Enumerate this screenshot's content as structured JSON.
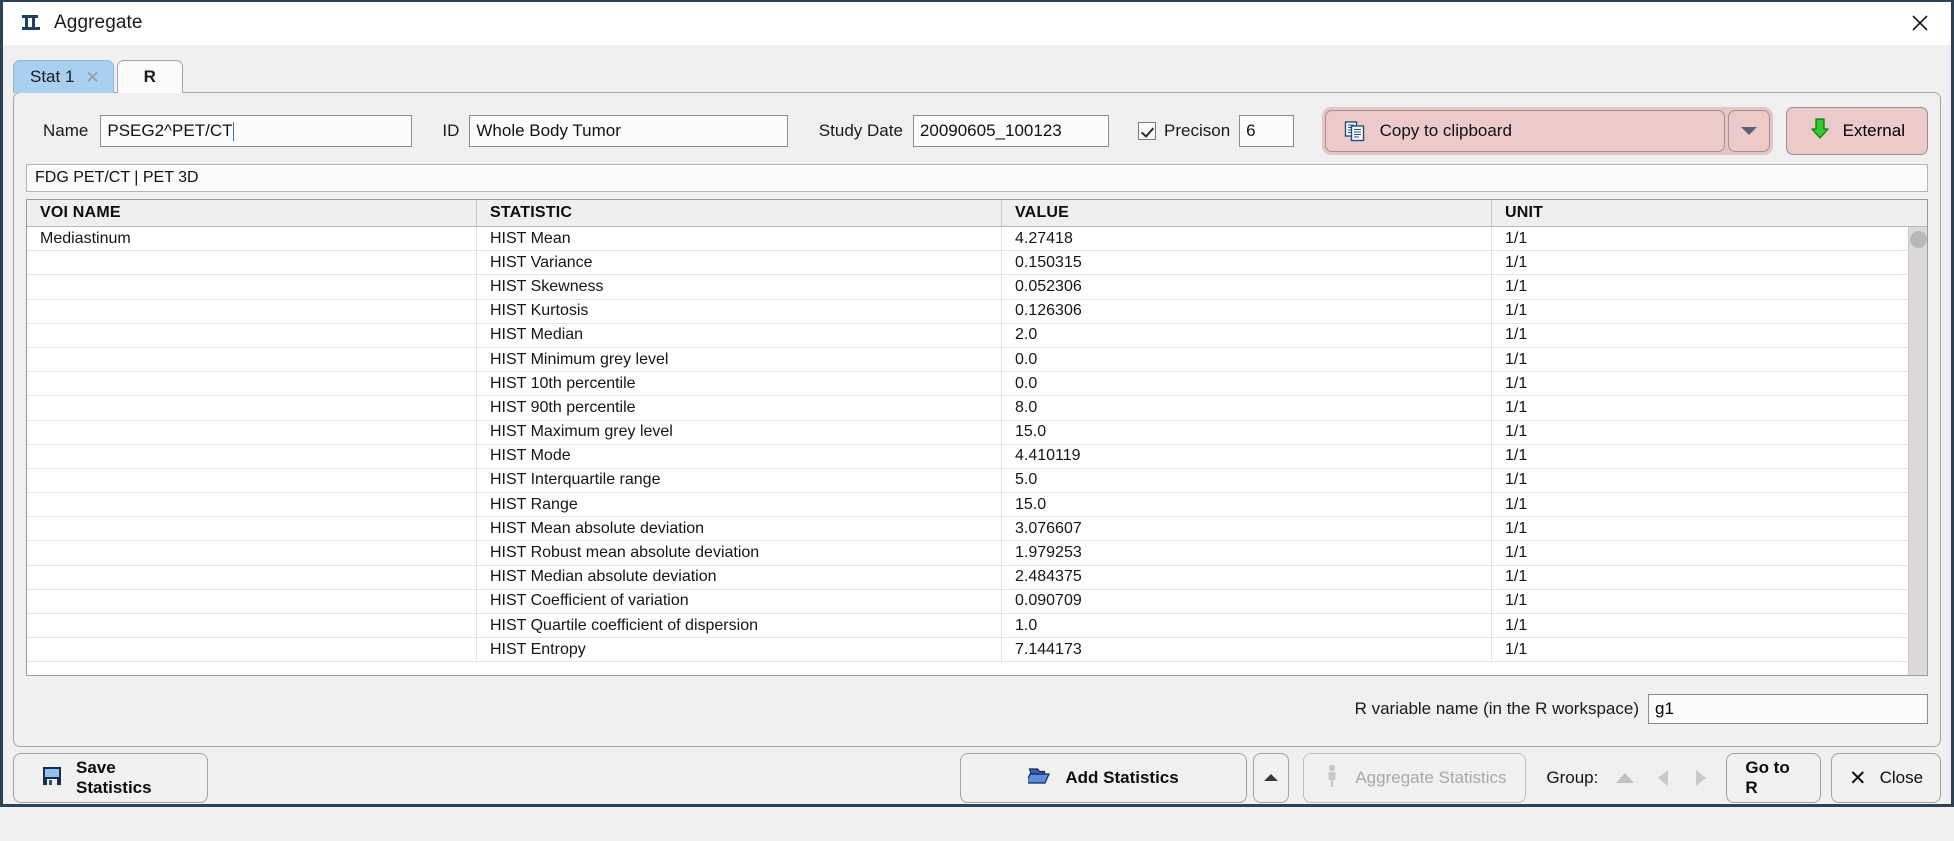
{
  "window": {
    "title": "Aggregate",
    "icon": "aggregate-icon",
    "close_icon": "close-icon"
  },
  "tabs": [
    {
      "label": "Stat 1",
      "active": true,
      "closable": true,
      "close_glyph": "✕"
    },
    {
      "label": "R",
      "active": false,
      "closable": false
    }
  ],
  "fields": {
    "name_label": "Name",
    "name_value": "PSEG2^PET/CT",
    "id_label": "ID",
    "id_value": "Whole Body Tumor",
    "study_date_label": "Study Date",
    "study_date_value": "20090605_100123",
    "precision_label": "Precison",
    "precision_checked": true,
    "precision_value": "6"
  },
  "toolbar": {
    "copy_label": "Copy to clipboard",
    "copy_icon": "copy-clipboard-icon",
    "dropdown_icon": "chevron-down-icon",
    "external_label": "External",
    "external_icon": "green-down-arrow-icon",
    "accent_pink": "#eccaca",
    "accent_green": "#33cc33"
  },
  "subtitle": "FDG PET/CT | PET 3D",
  "table": {
    "columns": [
      "VOI NAME",
      "STATISTIC",
      "VALUE",
      "UNIT"
    ],
    "rows": [
      {
        "voi": "Mediastinum",
        "statistic": "HIST Mean",
        "value": "4.27418",
        "unit": "1/1"
      },
      {
        "voi": "",
        "statistic": "HIST Variance",
        "value": "0.150315",
        "unit": "1/1"
      },
      {
        "voi": "",
        "statistic": "HIST Skewness",
        "value": "0.052306",
        "unit": "1/1"
      },
      {
        "voi": "",
        "statistic": "HIST Kurtosis",
        "value": "0.126306",
        "unit": "1/1"
      },
      {
        "voi": "",
        "statistic": "HIST Median",
        "value": "2.0",
        "unit": "1/1"
      },
      {
        "voi": "",
        "statistic": "HIST Minimum grey level",
        "value": "0.0",
        "unit": "1/1"
      },
      {
        "voi": "",
        "statistic": "HIST 10th percentile",
        "value": "0.0",
        "unit": "1/1"
      },
      {
        "voi": "",
        "statistic": "HIST 90th percentile",
        "value": "8.0",
        "unit": "1/1"
      },
      {
        "voi": "",
        "statistic": "HIST Maximum grey level",
        "value": "15.0",
        "unit": "1/1"
      },
      {
        "voi": "",
        "statistic": "HIST Mode",
        "value": "4.410119",
        "unit": "1/1"
      },
      {
        "voi": "",
        "statistic": "HIST Interquartile range",
        "value": "5.0",
        "unit": "1/1"
      },
      {
        "voi": "",
        "statistic": "HIST Range",
        "value": "15.0",
        "unit": "1/1"
      },
      {
        "voi": "",
        "statistic": "HIST Mean absolute deviation",
        "value": "3.076607",
        "unit": "1/1"
      },
      {
        "voi": "",
        "statistic": "HIST Robust mean absolute deviation",
        "value": "1.979253",
        "unit": "1/1"
      },
      {
        "voi": "",
        "statistic": "HIST Median absolute deviation",
        "value": "2.484375",
        "unit": "1/1"
      },
      {
        "voi": "",
        "statistic": "HIST Coefficient of variation",
        "value": "0.090709",
        "unit": "1/1"
      },
      {
        "voi": "",
        "statistic": "HIST Quartile coefficient of dispersion",
        "value": "1.0",
        "unit": "1/1"
      },
      {
        "voi": "",
        "statistic": "HIST Entropy",
        "value": "7.144173",
        "unit": "1/1"
      }
    ]
  },
  "rvariable": {
    "label": "R variable name (in the R workspace)",
    "value": "g1"
  },
  "bottom": {
    "save_label": "Save Statistics",
    "save_icon": "floppy-disk-icon",
    "add_label": "Add Statistics",
    "add_icon": "open-folder-icon",
    "eject_icon": "eject-icon",
    "aggregate_label": "Aggregate Statistics",
    "aggregate_icon": "person-icon",
    "aggregate_disabled": true,
    "group_label": "Group:",
    "group_up_icon": "triangle-up-icon",
    "group_prev_icon": "triangle-left-icon",
    "group_next_icon": "triangle-right-icon",
    "goto_r_label": "Go to R",
    "close_label": "Close",
    "close_icon": "x-icon"
  }
}
